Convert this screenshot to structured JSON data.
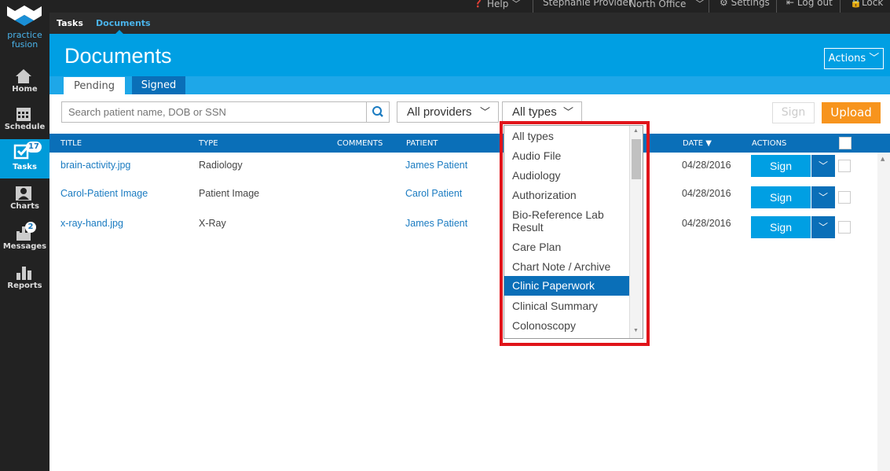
{
  "brand": {
    "line1": "practice",
    "line2": "fusion"
  },
  "sidebar": {
    "items": [
      {
        "label": "Home"
      },
      {
        "label": "Schedule"
      },
      {
        "label": "Tasks",
        "badge": "17"
      },
      {
        "label": "Charts"
      },
      {
        "label": "Messages",
        "badge": "2"
      },
      {
        "label": "Reports"
      }
    ]
  },
  "topbar": {
    "help": "Help",
    "user": "Stephanie Provider",
    "office": "North Office",
    "settings": "Settings",
    "logout": "Log out",
    "lock": "Lock"
  },
  "subnav": {
    "tasks": "Tasks",
    "documents": "Documents"
  },
  "header": {
    "title": "Documents",
    "actions": "Actions"
  },
  "tabs": {
    "pending": "Pending",
    "signed": "Signed"
  },
  "filters": {
    "search_placeholder": "Search patient name, DOB or SSN",
    "providers": "All providers",
    "types": "All types",
    "sign": "Sign",
    "upload": "Upload"
  },
  "table": {
    "headers": {
      "title": "TITLE",
      "type": "TYPE",
      "comments": "COMMENTS",
      "patient": "PATIENT",
      "date": "DATE",
      "actions": "ACTIONS"
    },
    "rows": [
      {
        "title": "brain-activity.jpg",
        "type": "Radiology",
        "patient": "James Patient",
        "date": "04/28/2016",
        "sign": "Sign"
      },
      {
        "title": "Carol-Patient Image",
        "type": "Patient Image",
        "patient": "Carol Patient",
        "date": "04/28/2016",
        "sign": "Sign"
      },
      {
        "title": "x-ray-hand.jpg",
        "type": "X-Ray",
        "patient": "James Patient",
        "date": "04/28/2016",
        "sign": "Sign"
      }
    ]
  },
  "type_dropdown": {
    "options": [
      "All types",
      "Audio File",
      "Audiology",
      "Authorization",
      "Bio-Reference Lab Result",
      "Care Plan",
      "Chart Note / Archive",
      "Clinic Paperwork",
      "Clinical Summary",
      "Colonoscopy"
    ],
    "selected": "Clinic Paperwork"
  },
  "colors": {
    "accent": "#009fe3",
    "dark_blue": "#0a6fb8",
    "upload": "#f7941d",
    "highlight": "#e0141a"
  }
}
